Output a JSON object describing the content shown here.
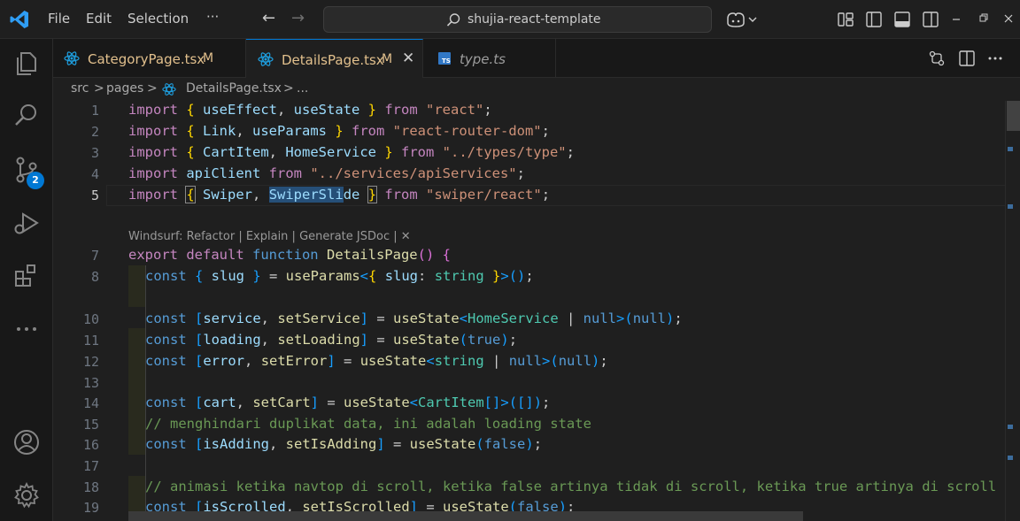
{
  "menu": {
    "file": "File",
    "edit": "Edit",
    "selection": "Selection",
    "more": "···"
  },
  "search": {
    "text": "shujia-react-template"
  },
  "scm_badge": "2",
  "tabs": [
    {
      "label": "CategoryPage.tsx",
      "modified": "M"
    },
    {
      "label": "DetailsPage.tsx",
      "modified": "M",
      "close": "✕"
    },
    {
      "label": "type.ts"
    }
  ],
  "breadcrumb": {
    "src": "src",
    "sep": ">",
    "pages": "pages",
    "file": "DetailsPage.tsx",
    "more": "..."
  },
  "codelens": "Windsurf: Refactor | Explain | Generate JSDoc | ✕",
  "line_numbers": [
    "1",
    "2",
    "3",
    "4",
    "5",
    "7",
    "8",
    "10",
    "11",
    "12",
    "13",
    "14",
    "15",
    "16",
    "17",
    "18",
    "19"
  ],
  "code": {
    "l1": {
      "a": "import ",
      "b": "{ ",
      "c": "useEffect",
      "d": ", ",
      "e": "useState",
      "f": " }",
      "g": " from ",
      "h": "\"react\"",
      "i": ";"
    },
    "l2": {
      "a": "import ",
      "b": "{ ",
      "c": "Link",
      "d": ", ",
      "e": "useParams",
      "f": " }",
      "g": " from ",
      "h": "\"react-router-dom\"",
      "i": ";"
    },
    "l3": {
      "a": "import ",
      "b": "{ ",
      "c": "CartItem",
      "d": ", ",
      "e": "HomeService",
      "f": " }",
      "g": " from ",
      "h": "\"../types/type\"",
      "i": ";"
    },
    "l4": {
      "a": "import ",
      "c": "apiClient",
      "g": " from ",
      "h": "\"../services/apiServices\"",
      "i": ";"
    },
    "l5": {
      "a": "import ",
      "b": "{",
      "sp": " ",
      "c": "Swiper",
      "d": ", ",
      "e1": "SwiperSli",
      "e2": "de",
      "sp2": " ",
      "f": "}",
      "g": " from ",
      "h": "\"swiper/react\"",
      "i": ";"
    },
    "l7": {
      "a": "export ",
      "b": "default ",
      "c": "function ",
      "d": "DetailsPage",
      "e": "()",
      "f": " ",
      "g": "{"
    },
    "l8": {
      "a": "const ",
      "b": "{ ",
      "c": "slug",
      "d": " }",
      "e": " = ",
      "f": "useParams",
      "g": "<",
      "h": "{ ",
      "i": "slug",
      "j": ": ",
      "k": "string",
      "l": " }",
      "m": ">",
      "n": "()",
      "o": ";"
    },
    "l10": {
      "a": "const ",
      "b": "[",
      "c": "service",
      "d": ", ",
      "e": "setService",
      "f": "]",
      "g": " = ",
      "h": "useState",
      "i": "<",
      "j": "HomeService",
      "k": " | ",
      "l": "null",
      "m": ">",
      "n": "(",
      "o": "null",
      "p": ")",
      "q": ";"
    },
    "l11": {
      "a": "const ",
      "b": "[",
      "c": "loading",
      "d": ", ",
      "e": "setLoading",
      "f": "]",
      "g": " = ",
      "h": "useState",
      "n": "(",
      "o": "true",
      "p": ")",
      "q": ";"
    },
    "l12": {
      "a": "const ",
      "b": "[",
      "c": "error",
      "d": ", ",
      "e": "setError",
      "f": "]",
      "g": " = ",
      "h": "useState",
      "i": "<",
      "j": "string",
      "k": " | ",
      "l": "null",
      "m": ">",
      "n": "(",
      "o": "null",
      "p": ")",
      "q": ";"
    },
    "l14": {
      "a": "const ",
      "b": "[",
      "c": "cart",
      "d": ", ",
      "e": "setCart",
      "f": "]",
      "g": " = ",
      "h": "useState",
      "i": "<",
      "j": "CartItem",
      "k": "[]",
      "m": ">",
      "n": "(",
      "o": "[]",
      "p": ")",
      "q": ";"
    },
    "l15": "// menghindari duplikat data, ini adalah loading state",
    "l16": {
      "a": "const ",
      "b": "[",
      "c": "isAdding",
      "d": ", ",
      "e": "setIsAdding",
      "f": "]",
      "g": " = ",
      "h": "useState",
      "n": "(",
      "o": "false",
      "p": ")",
      "q": ";"
    },
    "l18": "// animasi ketika navtop di scroll, ketika false artinya tidak di scroll, ketika true artinya di scroll",
    "l19": {
      "a": "const ",
      "b": "[",
      "c": "isScrolled",
      "d": ", ",
      "e": "setIsScrolled",
      "f": "]",
      "g": " = ",
      "h": "useState",
      "n": "(",
      "o": "false",
      "p": ")",
      "q": ";"
    }
  },
  "colors": {
    "accent": "#0078d4",
    "keyword": "#c586c0",
    "variable": "#9cdcfe",
    "function": "#dcdcaa",
    "string": "#ce9178",
    "type": "#4ec9b0",
    "comment": "#6a9955"
  }
}
